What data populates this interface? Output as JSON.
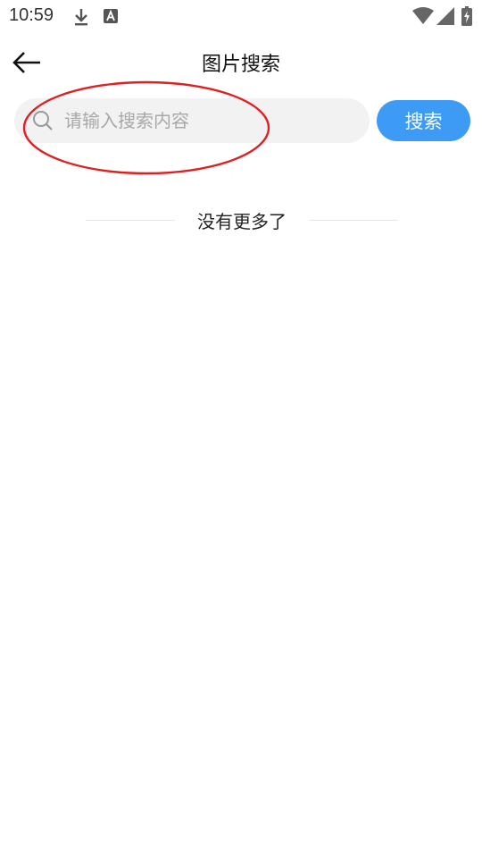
{
  "status_bar": {
    "time": "10:59"
  },
  "header": {
    "title": "图片搜索"
  },
  "search": {
    "placeholder": "请输入搜索内容",
    "value": "",
    "button_label": "搜索"
  },
  "list": {
    "end_text": "没有更多了"
  },
  "colors": {
    "accent": "#3d9bf5",
    "annotation": "#e02020",
    "search_bg": "#f2f2f2"
  },
  "icons": [
    "download-icon",
    "text-a-icon",
    "wifi-icon",
    "signal-icon",
    "battery-icon",
    "back-arrow-icon",
    "search-icon"
  ]
}
